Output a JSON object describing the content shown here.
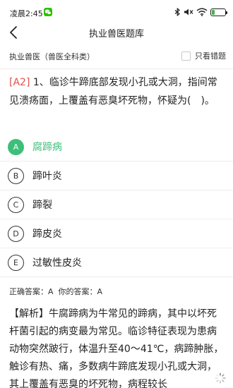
{
  "status_bar": {
    "time": "凌晨2:45",
    "battery_level": "21",
    "icons": [
      "wechat-icon",
      "bluetooth-icon",
      "mute-icon",
      "wifi-icon",
      "battery-icon"
    ]
  },
  "header": {
    "title": "执业兽医题库",
    "back_icon": "chevron-left-icon"
  },
  "subject": {
    "label": "执业兽医（兽医全科类）",
    "only_wrong_label": "只看错题",
    "only_wrong_checked": false
  },
  "question": {
    "tag": "[A2]",
    "text": " 1、临诊牛蹄底部发现小孔或大洞，指间常见溃疡面，上覆盖有恶臭坏死物，怀疑为(　)。"
  },
  "options": [
    {
      "letter": "A",
      "text": "腐蹄病",
      "state": "correct"
    },
    {
      "letter": "B",
      "text": "蹄叶炎",
      "state": "normal"
    },
    {
      "letter": "C",
      "text": "蹄裂",
      "state": "normal"
    },
    {
      "letter": "D",
      "text": "蹄皮炎",
      "state": "normal"
    },
    {
      "letter": "E",
      "text": "过敏性皮炎",
      "state": "normal"
    }
  ],
  "answer": {
    "correct_label": "正确答案：",
    "correct_value": "A",
    "yours_label": "你的答案：",
    "yours_value": "A"
  },
  "explanation": {
    "text": "【解析】牛腐蹄病为牛常见的蹄病，其中以坏死杆菌引起的病变最为常见。临诊特征表现为患病动物突然跛行，体温升至40～41℃，病蹄肿胀，触诊有热、痛，多数病牛蹄底发现小孔或大洞，其上覆盖有恶臭的坏死物，病程较长"
  },
  "colors": {
    "correct": "#3dbf7a",
    "tag": "#e0504f",
    "battery": "#4caf50"
  }
}
